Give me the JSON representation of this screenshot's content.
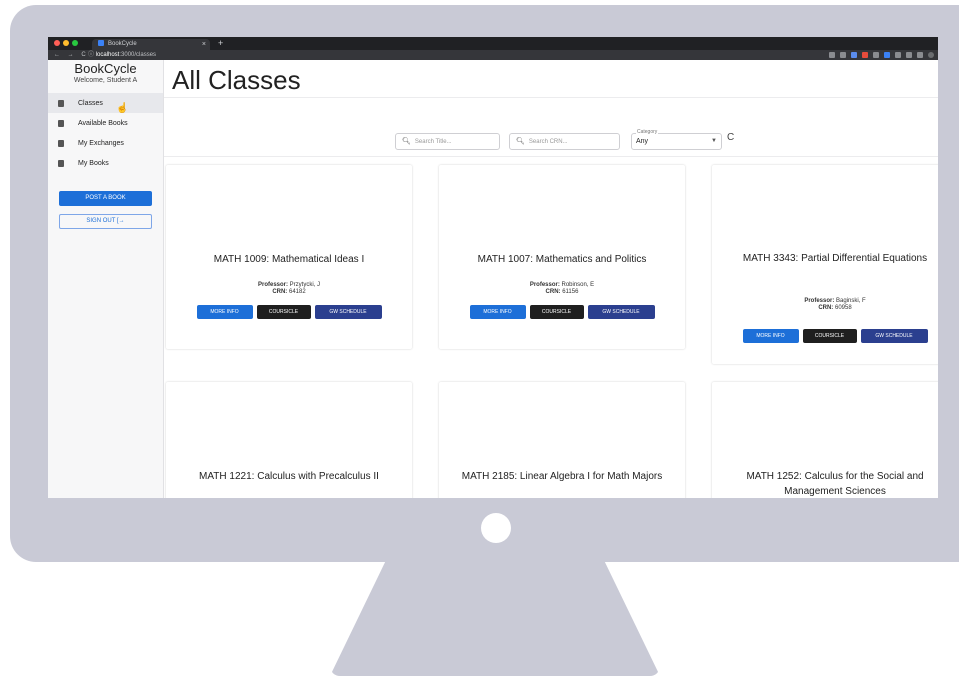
{
  "browser": {
    "tab_title": "BookCycle",
    "tab_close": "×",
    "new_tab": "+",
    "nav_glyphs": "← → C",
    "url_host": "localhost",
    "url_path": ":3000/classes"
  },
  "sidebar": {
    "brand": "BookCycle",
    "welcome": "Welcome, Student A",
    "items": [
      {
        "label": "Classes"
      },
      {
        "label": "Available Books"
      },
      {
        "label": "My Exchanges"
      },
      {
        "label": "My Books"
      }
    ],
    "post_button": "POST A BOOK",
    "signout_button": "SIGN OUT"
  },
  "main": {
    "title": "All Classes",
    "search_title_placeholder": "Search Title...",
    "search_crn_placeholder": "Search CRN...",
    "category_label": "Category",
    "category_value": "Any",
    "refresh_glyph": "C",
    "professor_label": "Professor:",
    "crn_label": "CRN:",
    "buttons": {
      "more_info": "MORE INFO",
      "coursicle": "COURSICLE",
      "schedule": "GW SCHEDULE"
    },
    "cards": [
      {
        "title": "MATH 1009: Mathematical Ideas I",
        "professor": "Przytycki, J",
        "crn": "64182"
      },
      {
        "title": "MATH 1007: Mathematics and Politics",
        "professor": "Robinson, E",
        "crn": "61156"
      },
      {
        "title": "MATH 3343: Partial Differential Equations",
        "professor": "Baginski, F",
        "crn": "60958"
      },
      {
        "title": "MATH 1221: Calculus with Precalculus II"
      },
      {
        "title": "MATH 2185: Linear Algebra I for Math Majors"
      },
      {
        "title": "MATH 1252: Calculus for the Social and Management Sciences"
      }
    ]
  },
  "colors": {
    "primary": "#1d6fd8",
    "dark": "#1f1f1f",
    "navy": "#2b3f8f",
    "monitor": "#c9cad6"
  }
}
